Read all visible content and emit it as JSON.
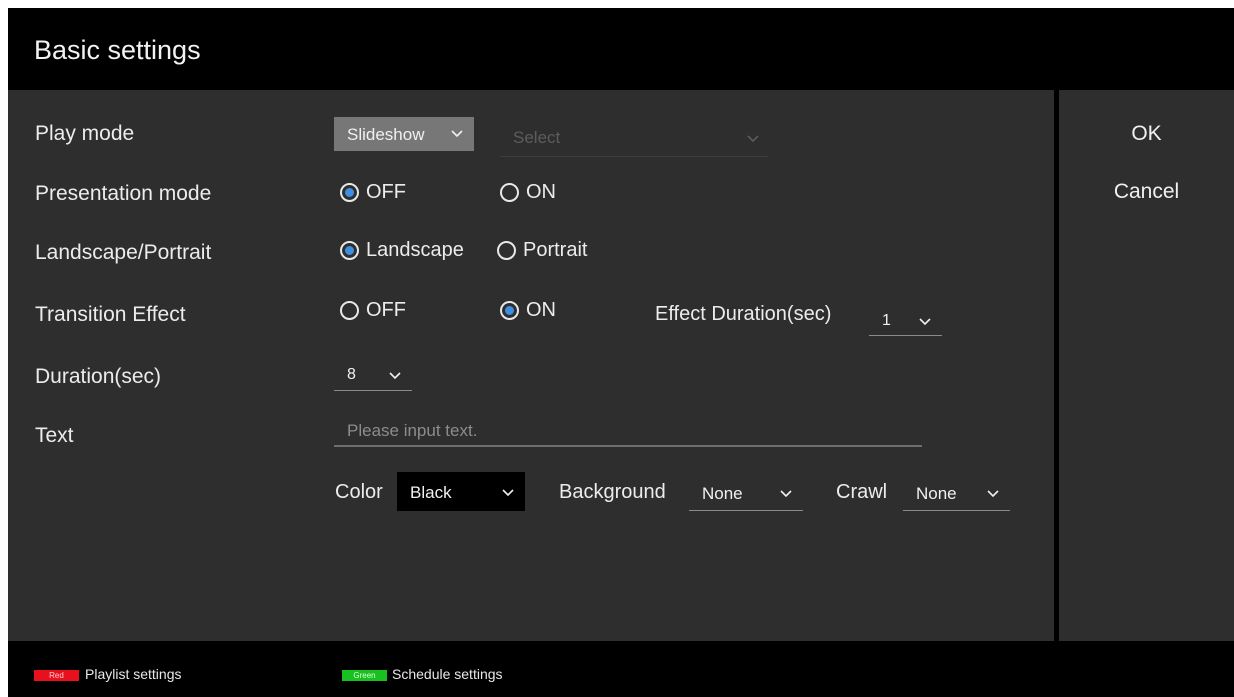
{
  "window": {
    "title": "Basic settings"
  },
  "rows": {
    "play_mode": {
      "label": "Play mode",
      "mode_value": "Slideshow",
      "select_placeholder": "Select"
    },
    "presentation_mode": {
      "label": "Presentation mode",
      "off": "OFF",
      "on": "ON",
      "selected": "OFF"
    },
    "orientation": {
      "label": "Landscape/Portrait",
      "landscape": "Landscape",
      "portrait": "Portrait",
      "selected": "Landscape"
    },
    "transition": {
      "label": "Transition Effect",
      "off": "OFF",
      "on": "ON",
      "selected": "ON",
      "duration_label": "Effect Duration(sec)",
      "duration_value": "1"
    },
    "duration": {
      "label": "Duration(sec)",
      "value": "8"
    },
    "text": {
      "label": "Text",
      "placeholder": "Please input text."
    },
    "text_style": {
      "color_label": "Color",
      "color_value": "Black",
      "background_label": "Background",
      "background_value": "None",
      "crawl_label": "Crawl",
      "crawl_value": "None"
    }
  },
  "side": {
    "ok": "OK",
    "cancel": "Cancel"
  },
  "footer": {
    "red_key": "Red",
    "red_label": "Playlist settings",
    "green_key": "Green",
    "green_label": "Schedule settings"
  },
  "colors": {
    "radio_selected": "#3f8fe0",
    "red_key": "#e8101c",
    "green_key": "#18c020"
  }
}
